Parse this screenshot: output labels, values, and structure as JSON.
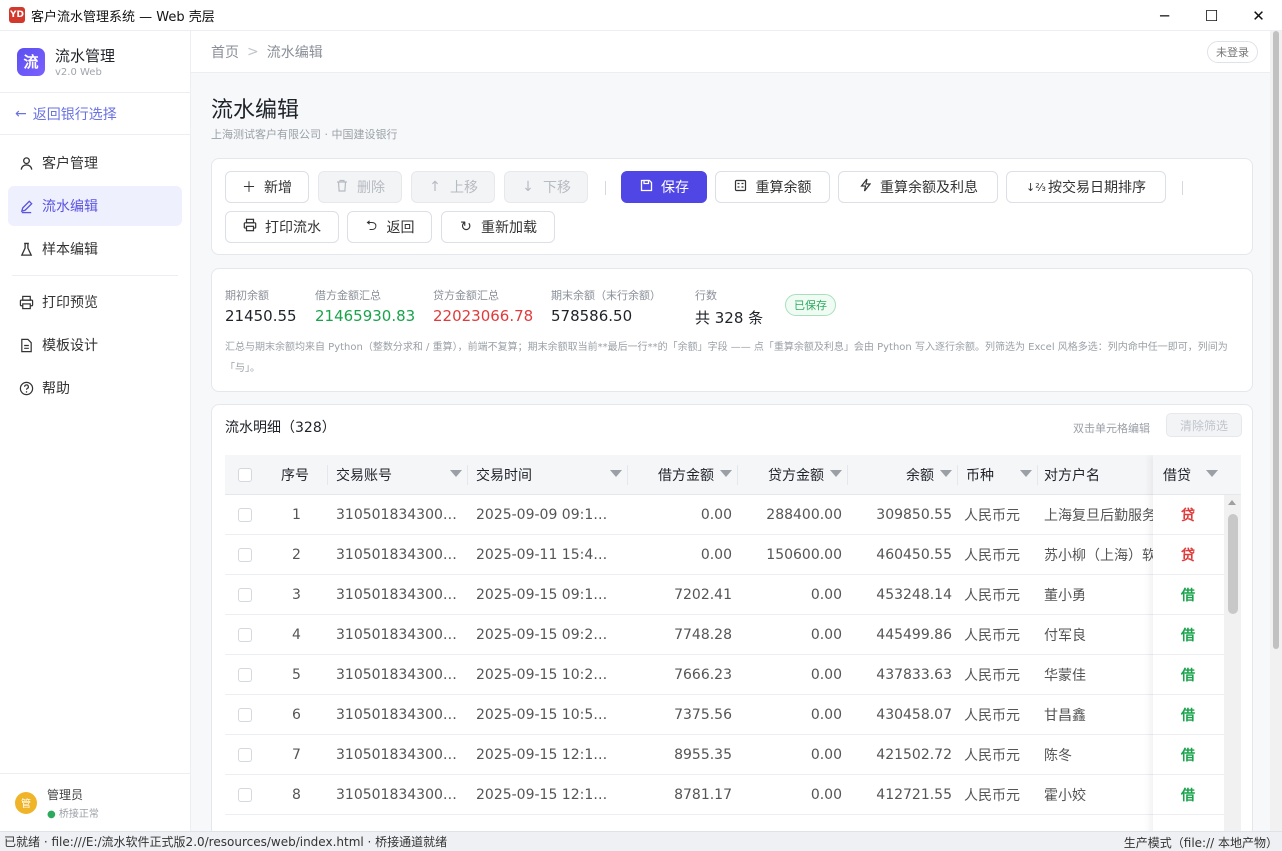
{
  "window": {
    "title": "客户流水管理系统 — Web 壳层",
    "app_icon": "YD",
    "controls": {
      "minimize": "─",
      "maximize": "☐",
      "close": "✕"
    }
  },
  "sidebar": {
    "brand_logo": "流",
    "brand_name": "流水管理",
    "brand_version": "v2.0 Web",
    "back_label": "返回银行选择",
    "items": [
      {
        "label": "客户管理",
        "icon": "user-icon"
      },
      {
        "label": "流水编辑",
        "icon": "pencil-icon",
        "active": true
      },
      {
        "label": "样本编辑",
        "icon": "flask-icon"
      },
      {
        "label": "打印预览",
        "icon": "printer-icon"
      },
      {
        "label": "模板设计",
        "icon": "document-icon"
      },
      {
        "label": "帮助",
        "icon": "help-icon"
      }
    ],
    "user": {
      "avatar": "管",
      "name": "管理员",
      "status": "桥接正常"
    }
  },
  "header": {
    "breadcrumb": [
      "首页",
      "流水编辑"
    ],
    "login_badge": "未登录",
    "title": "流水编辑",
    "subtitle": "上海测试客户有限公司 · 中国建设银行"
  },
  "toolbar": {
    "add": "新增",
    "delete": "删除",
    "move_up": "上移",
    "move_down": "下移",
    "save": "保存",
    "recalc_balance": "重算余额",
    "recalc_balance_interest": "重算余额及利息",
    "sort_by_date": "按交易日期排序",
    "print": "打印流水",
    "back": "返回",
    "reload": "重新加载"
  },
  "summary": {
    "opening_label": "期初余额",
    "opening_value": "21450.55",
    "debit_label": "借方金额汇总",
    "debit_value": "21465930.83",
    "credit_label": "贷方金额汇总",
    "credit_value": "22023066.78",
    "closing_label": "期末余额（末行余额）",
    "closing_value": "578586.50",
    "rows_label": "行数",
    "rows_value": "共 328 条",
    "saved_badge": "已保存",
    "note": "汇总与期末余额均来自 Python（整数分求和 / 重算），前端不复算；期末余额取当前**最后一行**的「余额」字段 —— 点「重算余额及利息」会由 Python 写入逐行余额。列筛选为 Excel 风格多选：列内命中任一即可，列间为「与」。",
    "colors": {
      "debit": "#19a34a",
      "credit": "#e03b3b"
    }
  },
  "detail": {
    "title": "流水明细（328）",
    "hint": "双击单元格编辑",
    "clear_filter": "清除筛选",
    "columns": [
      "序号",
      "交易账号",
      "交易时间",
      "借方金额",
      "贷方金额",
      "余额",
      "币种",
      "对方户名",
      "借贷"
    ],
    "rows": [
      {
        "no": "1",
        "account": "310501834300…",
        "time": "2025-09-09 09:1…",
        "debit": "0.00",
        "credit": "288400.00",
        "balance": "309850.55",
        "currency": "人民币元",
        "party": "上海复旦后勤服务",
        "dc": "贷"
      },
      {
        "no": "2",
        "account": "310501834300…",
        "time": "2025-09-11 15:4…",
        "debit": "0.00",
        "credit": "150600.00",
        "balance": "460450.55",
        "currency": "人民币元",
        "party": "苏小柳（上海）软",
        "dc": "贷"
      },
      {
        "no": "3",
        "account": "310501834300…",
        "time": "2025-09-15 09:1…",
        "debit": "7202.41",
        "credit": "0.00",
        "balance": "453248.14",
        "currency": "人民币元",
        "party": "董小勇",
        "dc": "借"
      },
      {
        "no": "4",
        "account": "310501834300…",
        "time": "2025-09-15 09:2…",
        "debit": "7748.28",
        "credit": "0.00",
        "balance": "445499.86",
        "currency": "人民币元",
        "party": "付军良",
        "dc": "借"
      },
      {
        "no": "5",
        "account": "310501834300…",
        "time": "2025-09-15 10:2…",
        "debit": "7666.23",
        "credit": "0.00",
        "balance": "437833.63",
        "currency": "人民币元",
        "party": "华蒙佳",
        "dc": "借"
      },
      {
        "no": "6",
        "account": "310501834300…",
        "time": "2025-09-15 10:5…",
        "debit": "7375.56",
        "credit": "0.00",
        "balance": "430458.07",
        "currency": "人民币元",
        "party": "甘昌鑫",
        "dc": "借"
      },
      {
        "no": "7",
        "account": "310501834300…",
        "time": "2025-09-15 12:1…",
        "debit": "8955.35",
        "credit": "0.00",
        "balance": "421502.72",
        "currency": "人民币元",
        "party": "陈冬",
        "dc": "借"
      },
      {
        "no": "8",
        "account": "310501834300…",
        "time": "2025-09-15 12:1…",
        "debit": "8781.17",
        "credit": "0.00",
        "balance": "412721.55",
        "currency": "人民币元",
        "party": "霍小姣",
        "dc": "借"
      }
    ]
  },
  "statusbar": {
    "left": "已就绪 · file:///E:/流水软件正式版2.0/resources/web/index.html · 桥接通道就绪",
    "right": "生产模式（file:// 本地产物）"
  }
}
